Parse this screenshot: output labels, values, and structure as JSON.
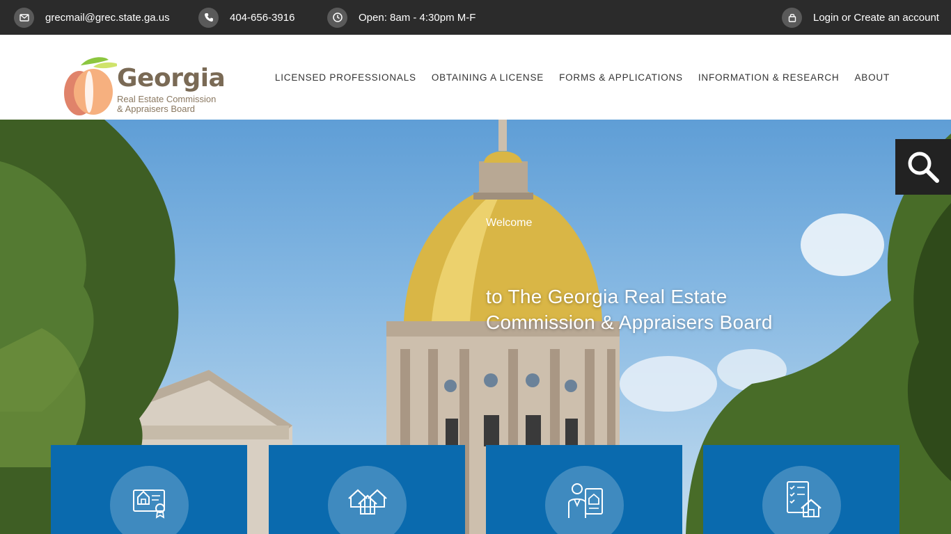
{
  "topbar": {
    "email": "grecmail@grec.state.ga.us",
    "phone": "404-656-3916",
    "hours": "Open: 8am - 4:30pm M-F",
    "login": "Login or Create an account",
    "icons": [
      "mail-icon",
      "phone-icon",
      "clock-icon",
      "lock-icon"
    ]
  },
  "logo": {
    "title": "Georgia",
    "line1": "Real Estate Commission",
    "line2": "& Appraisers Board"
  },
  "nav": {
    "items": [
      "LICENSED PROFESSIONALS",
      "OBTAINING A LICENSE",
      "FORMS & APPLICATIONS",
      "INFORMATION & RESEARCH",
      "ABOUT"
    ]
  },
  "hero": {
    "title": "Welcome",
    "subtitle": "to The Georgia Real Estate Commission & Appraisers Board"
  },
  "cards": {
    "icons": [
      "house-certificate-icon",
      "houses-icon",
      "agent-document-icon",
      "checklist-house-icon"
    ]
  },
  "colors": {
    "topbar": "#2b2b2b",
    "card": "#0a6aae",
    "search": "#222222"
  }
}
